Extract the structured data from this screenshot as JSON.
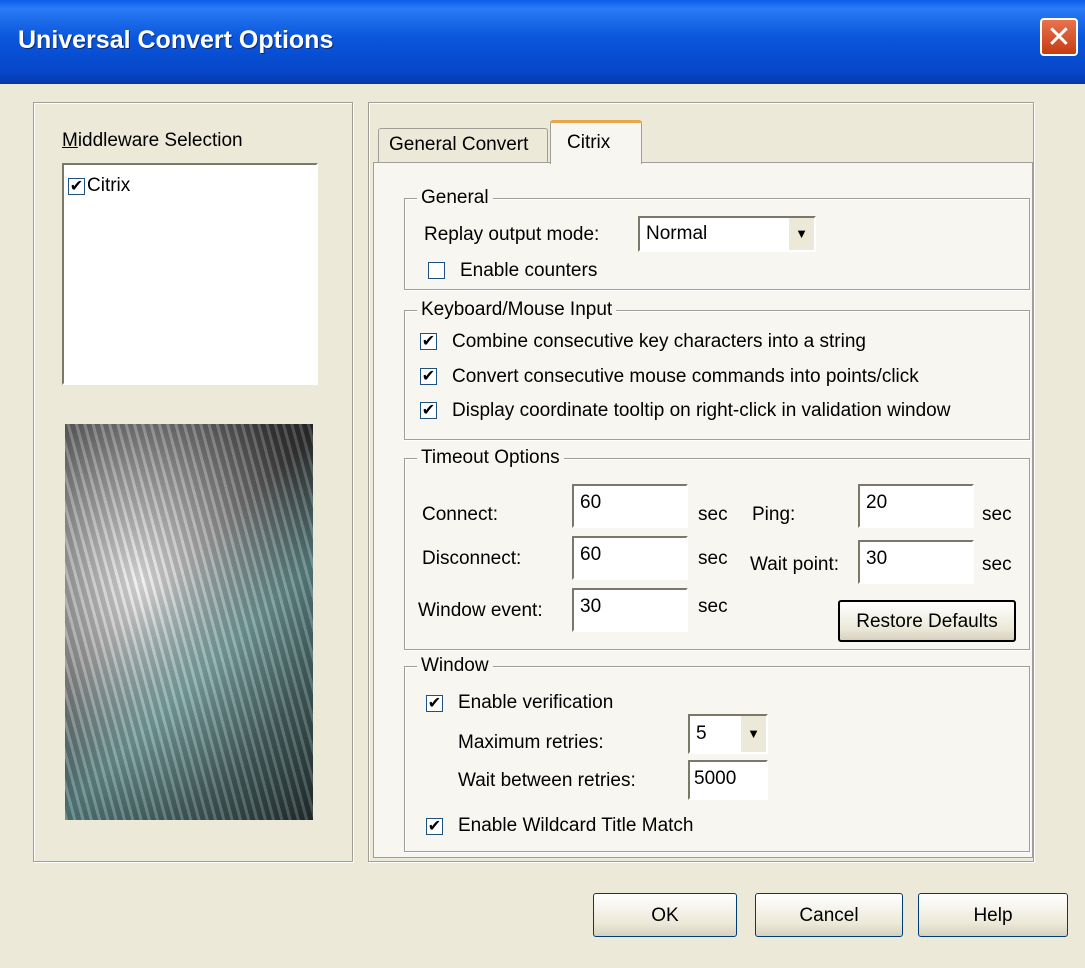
{
  "window": {
    "title": "Universal Convert Options",
    "close_icon": "close-icon"
  },
  "middleware": {
    "label": "Middleware Selection",
    "items": [
      {
        "label": "Citrix",
        "checked": true
      }
    ]
  },
  "tabs": [
    {
      "label": "General Convert"
    },
    {
      "label": "Citrix",
      "active": true
    }
  ],
  "general": {
    "title": "General",
    "replay_label": "Replay output mode:",
    "replay_value": "Normal",
    "counters_label": "Enable counters",
    "counters_checked": false
  },
  "keyboard": {
    "title": "Keyboard/Mouse Input",
    "items": [
      {
        "label": "Combine consecutive key characters into a string",
        "checked": true
      },
      {
        "label": "Convert consecutive mouse commands into points/click",
        "checked": true
      },
      {
        "label": "Display coordinate tooltip on right-click in validation window",
        "checked": true
      }
    ]
  },
  "timeout": {
    "title": "Timeout Options",
    "unit": "sec",
    "connect_label": "Connect:",
    "connect_value": "60",
    "disconnect_label": "Disconnect:",
    "disconnect_value": "60",
    "window_event_label": "Window event:",
    "window_event_value": "30",
    "ping_label": "Ping:",
    "ping_value": "20",
    "wait_point_label": "Wait point:",
    "wait_point_value": "30",
    "restore_label": "Restore Defaults"
  },
  "window_group": {
    "title": "Window",
    "verification_label": "Enable verification",
    "verification_checked": true,
    "max_retries_label": "Maximum retries:",
    "max_retries_value": "5",
    "wait_between_label": "Wait between retries:",
    "wait_between_value": "5000",
    "wildcard_label": "Enable Wildcard Title Match",
    "wildcard_checked": true
  },
  "footer": {
    "ok": "OK",
    "cancel": "Cancel",
    "help": "Help"
  },
  "check_mark": "✔",
  "dropdown_arrow": "▼"
}
